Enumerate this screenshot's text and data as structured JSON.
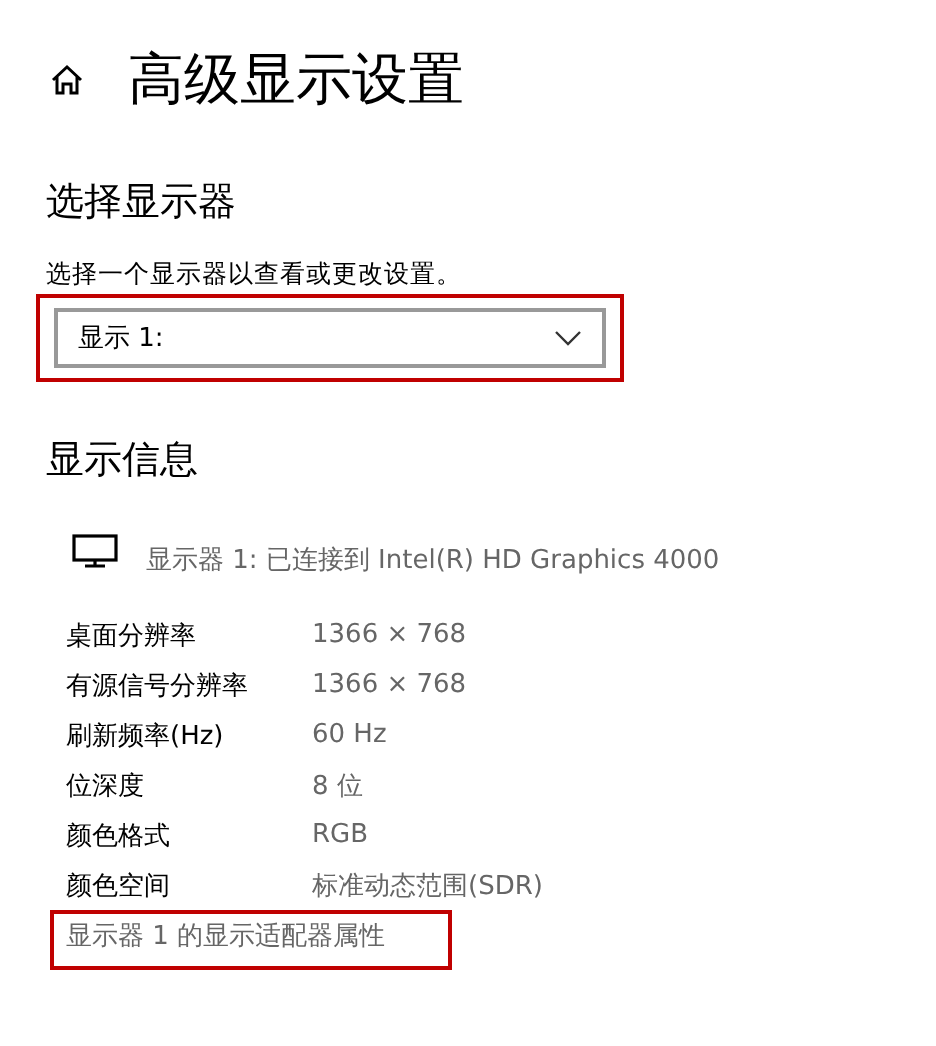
{
  "page": {
    "title": "高级显示设置"
  },
  "select_display": {
    "heading": "选择显示器",
    "description": "选择一个显示器以查看或更改设置。",
    "dropdown": {
      "value": "显示 1:",
      "highlighted": true
    }
  },
  "display_info": {
    "heading": "显示信息",
    "monitor_line": "显示器 1: 已连接到 Intel(R) HD Graphics 4000",
    "rows": [
      {
        "label": "桌面分辨率",
        "value": "1366 × 768"
      },
      {
        "label": "有源信号分辨率",
        "value": "1366 × 768"
      },
      {
        "label": "刷新频率(Hz)",
        "value": "60 Hz"
      },
      {
        "label": "位深度",
        "value": "8 位"
      },
      {
        "label": "颜色格式",
        "value": "RGB"
      },
      {
        "label": "颜色空间",
        "value": "标准动态范围(SDR)"
      }
    ],
    "adapter_link": {
      "text": "显示器 1 的显示适配器属性",
      "highlighted": true
    }
  }
}
